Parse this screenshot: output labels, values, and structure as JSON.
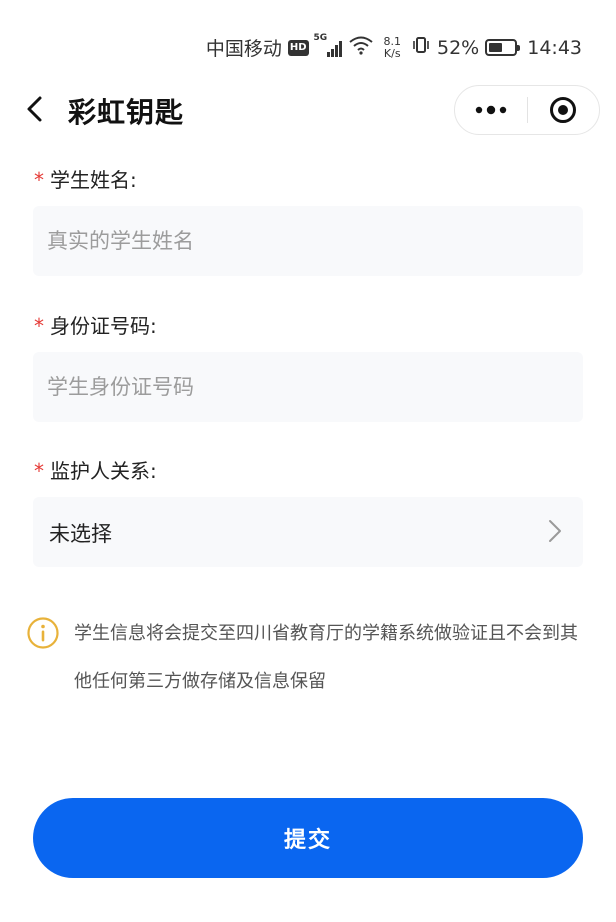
{
  "status_bar": {
    "carrier": "中国移动",
    "hd": "HD",
    "network": "5G",
    "net_speed_value": "8.1",
    "net_speed_unit": "K/s",
    "battery_percent": "52%",
    "battery_level": 0.52,
    "time": "14:43"
  },
  "nav": {
    "title": "彩虹钥匙"
  },
  "form": {
    "student_name": {
      "label": "学生姓名:",
      "placeholder": "真实的学生姓名",
      "value": ""
    },
    "id_number": {
      "label": "身份证号码:",
      "placeholder": "学生身份证号码",
      "value": ""
    },
    "guardian_relation": {
      "label": "监护人关系:",
      "selected": "未选择"
    },
    "required_mark": "*"
  },
  "notice": {
    "text": "学生信息将会提交至四川省教育厅的学籍系统做验证且不会到其他任何第三方做存储及信息保留"
  },
  "submit": {
    "label": "提交"
  },
  "colors": {
    "primary": "#0a66f0",
    "required": "#e53935",
    "notice_icon": "#e8b23a"
  }
}
